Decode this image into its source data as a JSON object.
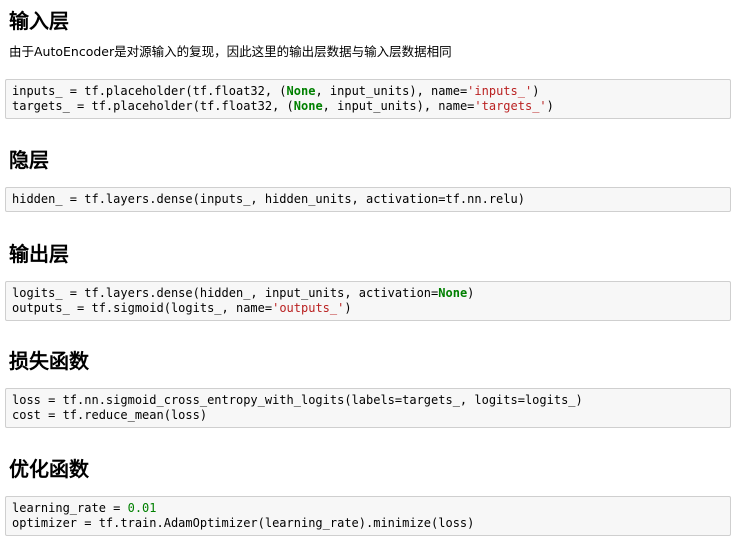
{
  "sections": [
    {
      "title": "输入层",
      "description": "由于AutoEncoder是对源输入的复现，因此这里的输出层数据与输入层数据相同",
      "code_lines": [
        [
          {
            "text": "inputs_ = tf.placeholder(tf.float32, (",
            "kind": "plain"
          },
          {
            "text": "None",
            "kind": "none"
          },
          {
            "text": ", input_units), name=",
            "kind": "plain"
          },
          {
            "text": "'inputs_'",
            "kind": "str"
          },
          {
            "text": ")",
            "kind": "plain"
          }
        ],
        [
          {
            "text": "targets_ = tf.placeholder(tf.float32, (",
            "kind": "plain"
          },
          {
            "text": "None",
            "kind": "none"
          },
          {
            "text": ", input_units), name=",
            "kind": "plain"
          },
          {
            "text": "'targets_'",
            "kind": "str"
          },
          {
            "text": ")",
            "kind": "plain"
          }
        ]
      ]
    },
    {
      "title": "隐层",
      "description": "",
      "code_lines": [
        [
          {
            "text": "hidden_ = tf.layers.dense(inputs_, hidden_units, activation=tf.nn.relu)",
            "kind": "plain"
          }
        ]
      ]
    },
    {
      "title": "输出层",
      "description": "",
      "code_lines": [
        [
          {
            "text": "logits_ = tf.layers.dense(hidden_, input_units, activation=",
            "kind": "plain"
          },
          {
            "text": "None",
            "kind": "none"
          },
          {
            "text": ")",
            "kind": "plain"
          }
        ],
        [
          {
            "text": "outputs_ = tf.sigmoid(logits_, name=",
            "kind": "plain"
          },
          {
            "text": "'outputs_'",
            "kind": "str"
          },
          {
            "text": ")",
            "kind": "plain"
          }
        ]
      ]
    },
    {
      "title": "损失函数",
      "description": "",
      "code_lines": [
        [
          {
            "text": "loss = tf.nn.sigmoid_cross_entropy_with_logits(labels=targets_, logits=logits_)",
            "kind": "plain"
          }
        ],
        [
          {
            "text": "cost = tf.reduce_mean(loss)",
            "kind": "plain"
          }
        ]
      ]
    },
    {
      "title": "优化函数",
      "description": "",
      "code_lines": [
        [
          {
            "text": "learning_rate = ",
            "kind": "plain"
          },
          {
            "text": "0.01",
            "kind": "num"
          }
        ],
        [
          {
            "text": "optimizer = tf.train.AdamOptimizer(learning_rate).minimize(loss)",
            "kind": "plain"
          }
        ]
      ]
    }
  ],
  "colors": {
    "keyword_none": "#008000",
    "string": "#ba2121",
    "number": "#008000",
    "cell_background": "#f7f7f7",
    "cell_border": "#cfcfcf"
  }
}
